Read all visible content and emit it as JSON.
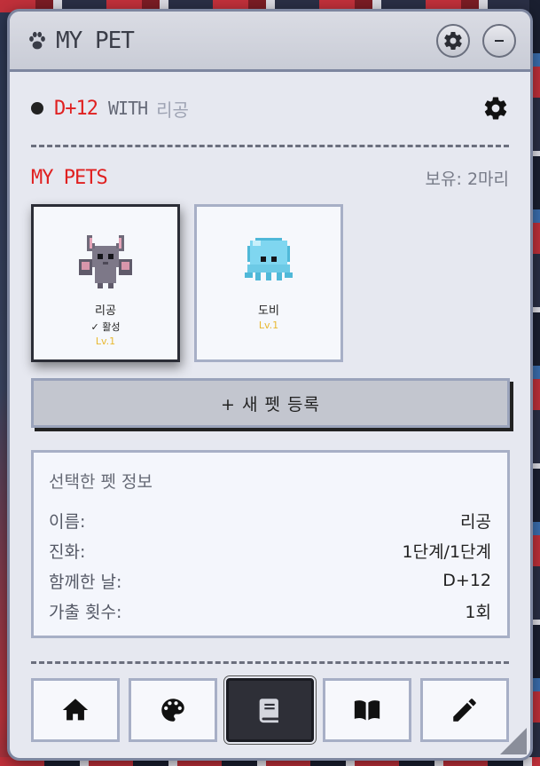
{
  "window": {
    "title": "MY PET",
    "icons": {
      "title_icon": "paw-icon",
      "settings": "gear-icon",
      "minimize": "minus-icon"
    }
  },
  "status": {
    "dday": "D+12",
    "with_label": "WITH",
    "pet_name": "리공",
    "settings_icon": "gear-icon"
  },
  "pets": {
    "heading": "MY PETS",
    "owned": "보유: 2마리",
    "items": [
      {
        "name": "리공",
        "active_label": "✓ 활성",
        "level": "Lv.1",
        "sprite": "bat-sprite",
        "active": true
      },
      {
        "name": "도비",
        "active_label": "",
        "level": "Lv.1",
        "sprite": "octopus-sprite",
        "active": false
      }
    ],
    "add_button": "+ 새 펫 등록"
  },
  "info": {
    "title": "선택한 펫 정보",
    "rows": [
      {
        "label": "이름:",
        "value": "리공"
      },
      {
        "label": "진화:",
        "value": "1단계/1단계"
      },
      {
        "label": "함께한 날:",
        "value": "D+12"
      },
      {
        "label": "가출 횟수:",
        "value": "1회"
      }
    ]
  },
  "nav": {
    "items": [
      {
        "icon": "home-icon",
        "active": false
      },
      {
        "icon": "palette-icon",
        "active": false
      },
      {
        "icon": "book-icon",
        "active": true
      },
      {
        "icon": "open-book-icon",
        "active": false
      },
      {
        "icon": "pencil-icon",
        "active": false
      }
    ]
  },
  "colors": {
    "accent_red": "#e02020",
    "level_yellow": "#e8b830",
    "panel_bg": "#e6e8f0",
    "border": "#a7afc6",
    "active_nav": "#2e2f37"
  }
}
